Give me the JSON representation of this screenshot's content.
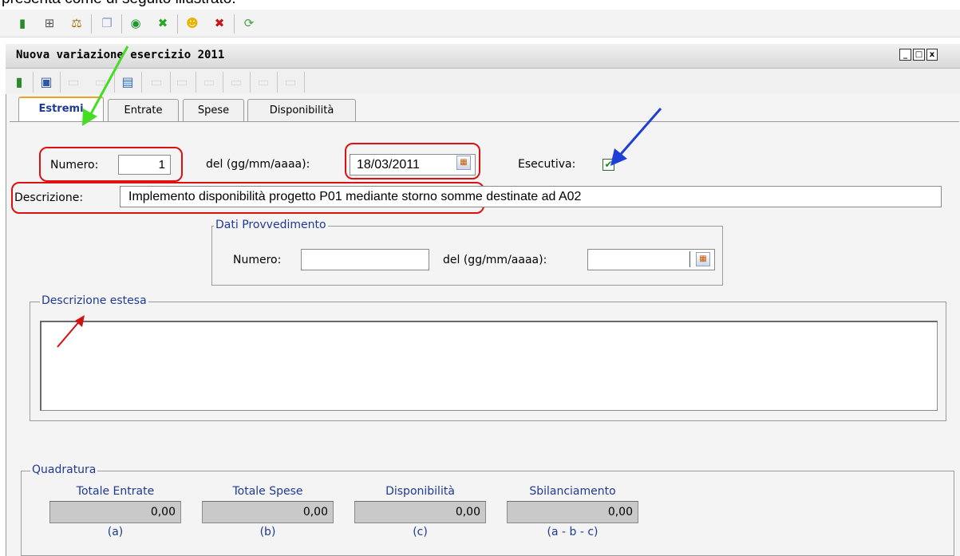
{
  "caption": "presenta come di seguito illustrato:",
  "window": {
    "title": "Nuova variazione esercizio 2011",
    "controls": [
      "_",
      "□",
      "x"
    ]
  },
  "tabs": [
    {
      "label": "Estremi",
      "active": true
    },
    {
      "label": "Entrate",
      "active": false
    },
    {
      "label": "Spese",
      "active": false
    },
    {
      "label": "Disponibilità",
      "active": false
    }
  ],
  "form": {
    "numero_label": "Numero:",
    "numero_value": "1",
    "del_label": "del (gg/mm/aaaa):",
    "date_value": "18/03/2011",
    "esecutiva_label": "Esecutiva:",
    "esecutiva_checked": true,
    "checkmark": "✔",
    "descrizione_label": "Descrizione:",
    "descrizione_value": "Implemento disponibilità progetto P01 mediante storno somme destinate ad A02"
  },
  "provvedimento": {
    "legend": "Dati Provvedimento",
    "numero_label": "Numero:",
    "numero_value": "",
    "del_label": "del (gg/mm/aaaa):",
    "date_value": ""
  },
  "descrizione_estesa": {
    "legend": "Descrizione estesa",
    "value": ""
  },
  "quadratura": {
    "legend": "Quadratura",
    "columns": [
      {
        "header": "Totale Entrate",
        "value": "0,00",
        "sub": "(a)"
      },
      {
        "header": "Totale Spese",
        "value": "0,00",
        "sub": "(b)"
      },
      {
        "header": "Disponibilità",
        "value": "0,00",
        "sub": "(c)"
      },
      {
        "header": "Sbilanciamento",
        "value": "0,00",
        "sub": "(a - b - c)"
      }
    ]
  },
  "colors": {
    "highlight_red": "#d11111",
    "arrow_green": "#44dd22",
    "arrow_blue": "#1e3fd6",
    "legend_blue": "#1f3a93"
  },
  "icons": {
    "toolbar_top": [
      "exit-icon",
      "tree-icon",
      "balance-icon",
      "copy-icon",
      "green-circle-icon",
      "green-cross-icon",
      "smiley-icon",
      "red-cross-icon",
      "refresh-icon"
    ],
    "toolbar_window": [
      "exit-icon",
      "save-icon",
      "blank-icon",
      "blank-icon",
      "table-icon",
      "blank-icon",
      "blank-icon",
      "blank-icon",
      "blank-icon",
      "blank-icon"
    ]
  }
}
